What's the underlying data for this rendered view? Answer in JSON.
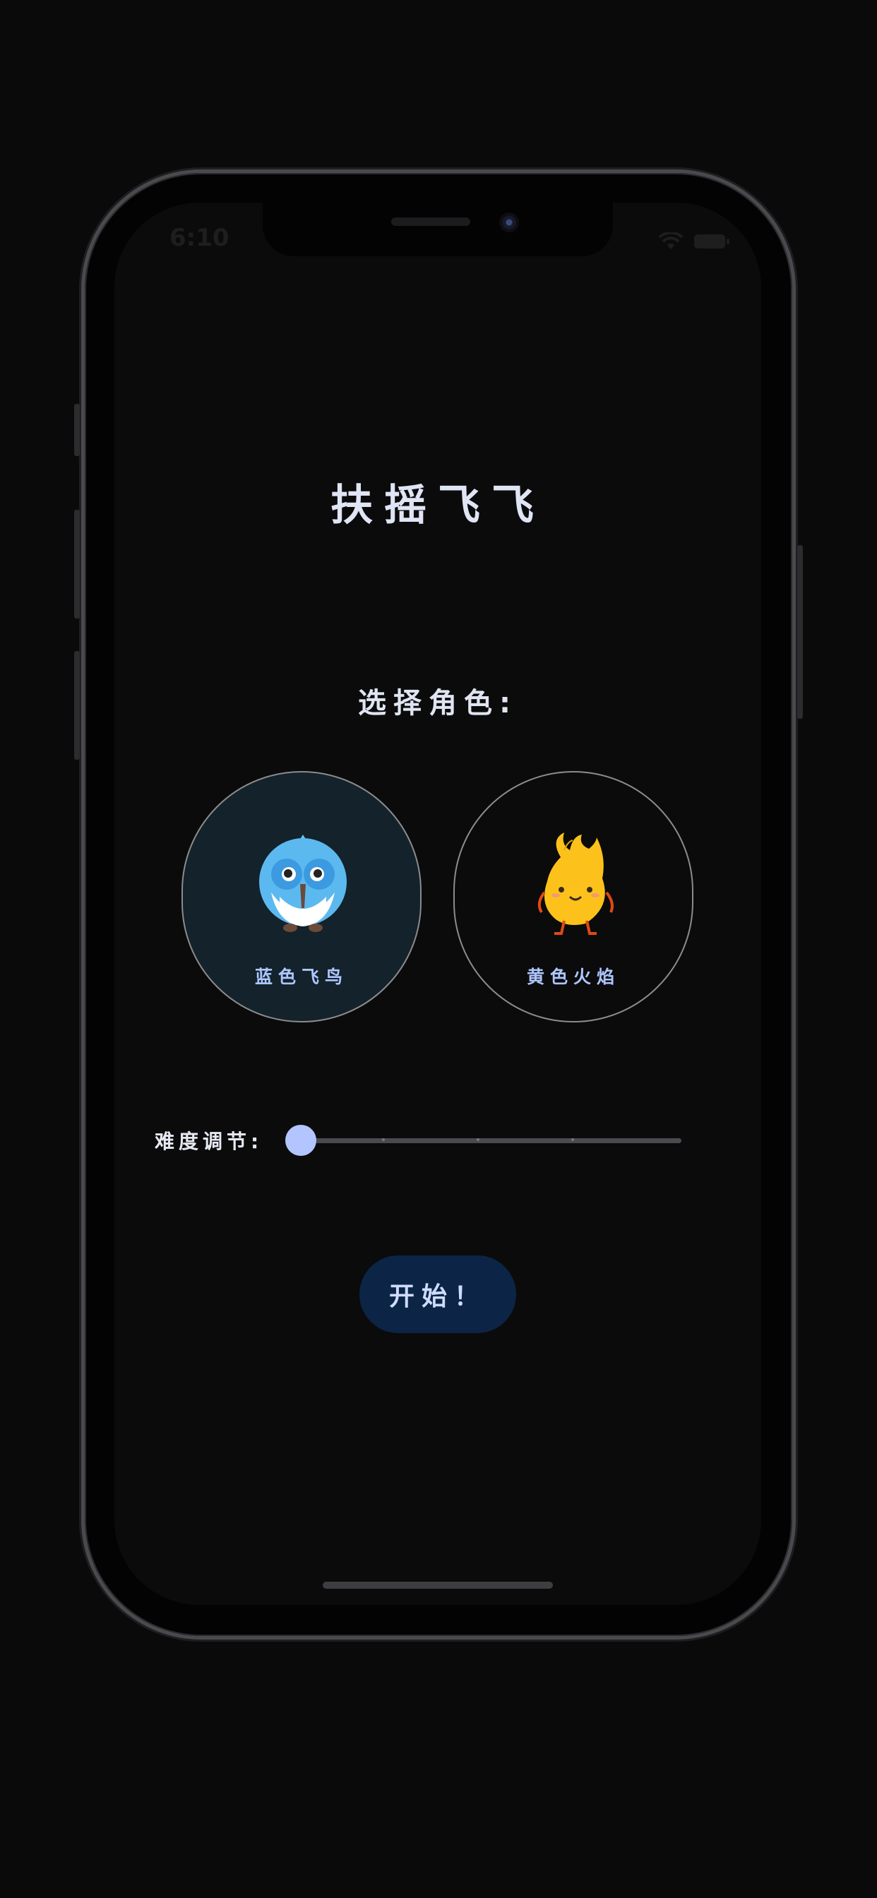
{
  "status_bar": {
    "time": "6:10",
    "wifi_icon": "wifi-icon",
    "battery_icon": "battery-icon"
  },
  "app": {
    "title": "扶摇飞飞",
    "choose_character": "选择角色:",
    "characters": [
      {
        "label": "蓝色飞鸟",
        "icon": "blue-bird-icon",
        "selected": true
      },
      {
        "label": "黄色火焰",
        "icon": "yellow-flame-icon",
        "selected": false
      }
    ],
    "difficulty": {
      "label": "难度调节:",
      "value": 0,
      "min": 0,
      "max": 4,
      "steps": 5
    },
    "start_button": "开始！"
  },
  "colors": {
    "background": "#0b0b0b",
    "selected_card": "#13222b",
    "accent": "#b2c5ff",
    "button_bg": "#0c2546"
  }
}
